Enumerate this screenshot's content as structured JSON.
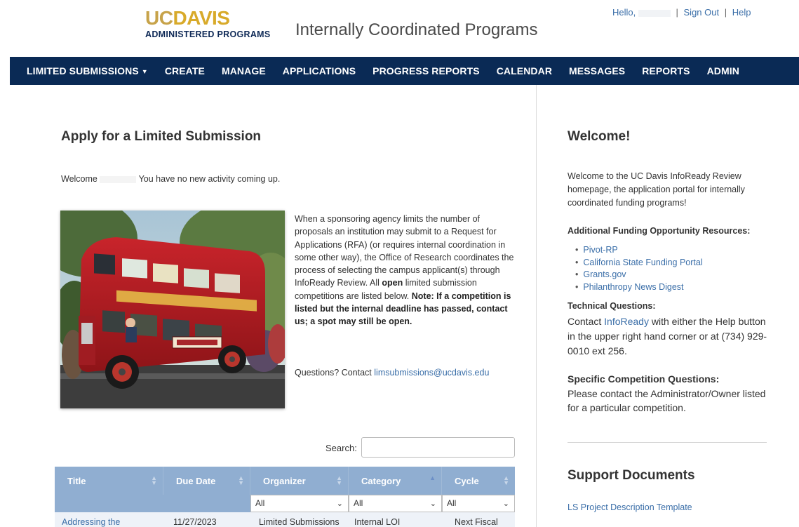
{
  "header": {
    "logo_uc": "UC",
    "logo_davis": "DAVIS",
    "logo_sub": "ADMINISTERED PROGRAMS",
    "site_title": "Internally Coordinated Programs",
    "hello": "Hello,",
    "sign_out": "Sign Out",
    "help": "Help"
  },
  "nav": {
    "items": [
      "LIMITED SUBMISSIONS",
      "CREATE",
      "MANAGE",
      "APPLICATIONS",
      "PROGRESS REPORTS",
      "CALENDAR",
      "MESSAGES",
      "REPORTS",
      "ADMIN"
    ]
  },
  "main": {
    "heading": "Apply for a Limited Submission",
    "welcome_prefix": "Welcome",
    "welcome_suffix": "You have no new activity coming up.",
    "intro_1": "When a sponsoring agency limits the number of proposals an institution may submit to a Request for Applications (RFA) (or requires internal coordination in some other way), the Office of Research coordinates the process of selecting the campus applicant(s) through InfoReady Review. All ",
    "intro_open": "open",
    "intro_2": " limited submission competitions are listed below.",
    "note_label": "Note",
    "note_text": ": If a competition is listed but the internal deadline has passed, contact us; a spot may still be open.",
    "questions_prefix": "Questions? Contact ",
    "questions_email": "limsubmissions@ucdavis.edu",
    "search_label": "Search:",
    "table": {
      "headers": [
        "Title",
        "Due Date",
        "Organizer",
        "Category",
        "Cycle"
      ],
      "filters": [
        "All",
        "All",
        "All"
      ],
      "row": [
        "Addressing the",
        "11/27/2023",
        "Limited Submissions",
        "Internal LOI",
        "Next Fiscal"
      ]
    }
  },
  "sidebar": {
    "heading": "Welcome!",
    "intro": "Welcome to the UC Davis InfoReady Review homepage, the application portal for internally coordinated funding programs!",
    "resources_title": "Additional Funding Opportunity Resources:",
    "resources": [
      "Pivot-RP",
      "California State Funding Portal",
      "Grants.gov",
      "Philanthropy News Digest"
    ],
    "tech_title": "Technical Questions:",
    "tech_prefix": "Contact ",
    "tech_link": "InfoReady",
    "tech_suffix": " with either the Help button in the upper right hand corner or at (734) 929-0010 ext 256.",
    "comp_title": "Specific Competition Questions:",
    "comp_text": "Please contact the Administrator/Owner listed for a particular competition.",
    "support_heading": "Support Documents",
    "support_link": "LS Project Description Template"
  }
}
